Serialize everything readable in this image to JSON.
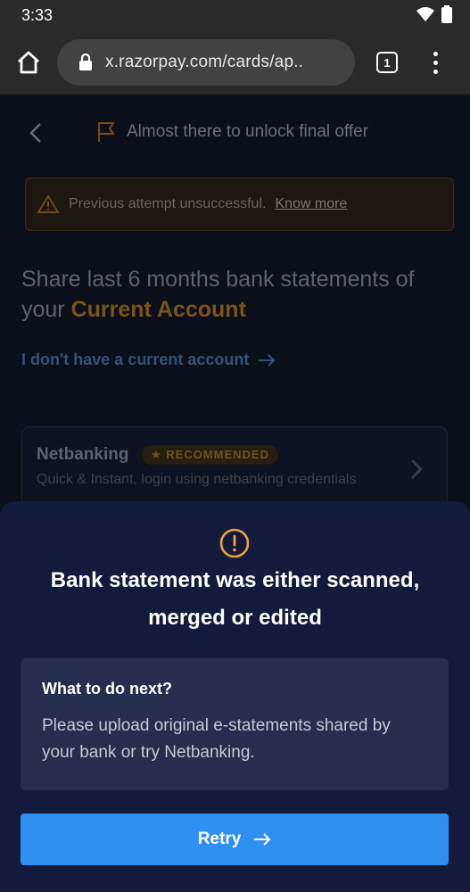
{
  "status_bar": {
    "time": "3:33"
  },
  "browser": {
    "url": "x.razorpay.com/cards/ap..",
    "tab_count": "1"
  },
  "page": {
    "header": "Almost there to unlock final offer",
    "alert": {
      "text": "Previous attempt unsuccessful.",
      "link": "Know more"
    },
    "heading_prefix": "Share last 6 months bank statements of your",
    "heading_accent": "Current Account",
    "no_account_link": "I don't have a current account",
    "option": {
      "title": "Netbanking",
      "badge": "★ RECOMMENDED",
      "subtitle": "Quick & Instant, login using netbanking credentials"
    }
  },
  "sheet": {
    "title_line1": "Bank statement was either scanned,",
    "title_line2": "merged or edited",
    "info_title": "What to do next?",
    "info_text": "Please upload original e-statements shared by your bank or try Netbanking.",
    "retry_label": "Retry",
    "accent_color": "#e8a33d",
    "button_color": "#2f8ff2"
  }
}
